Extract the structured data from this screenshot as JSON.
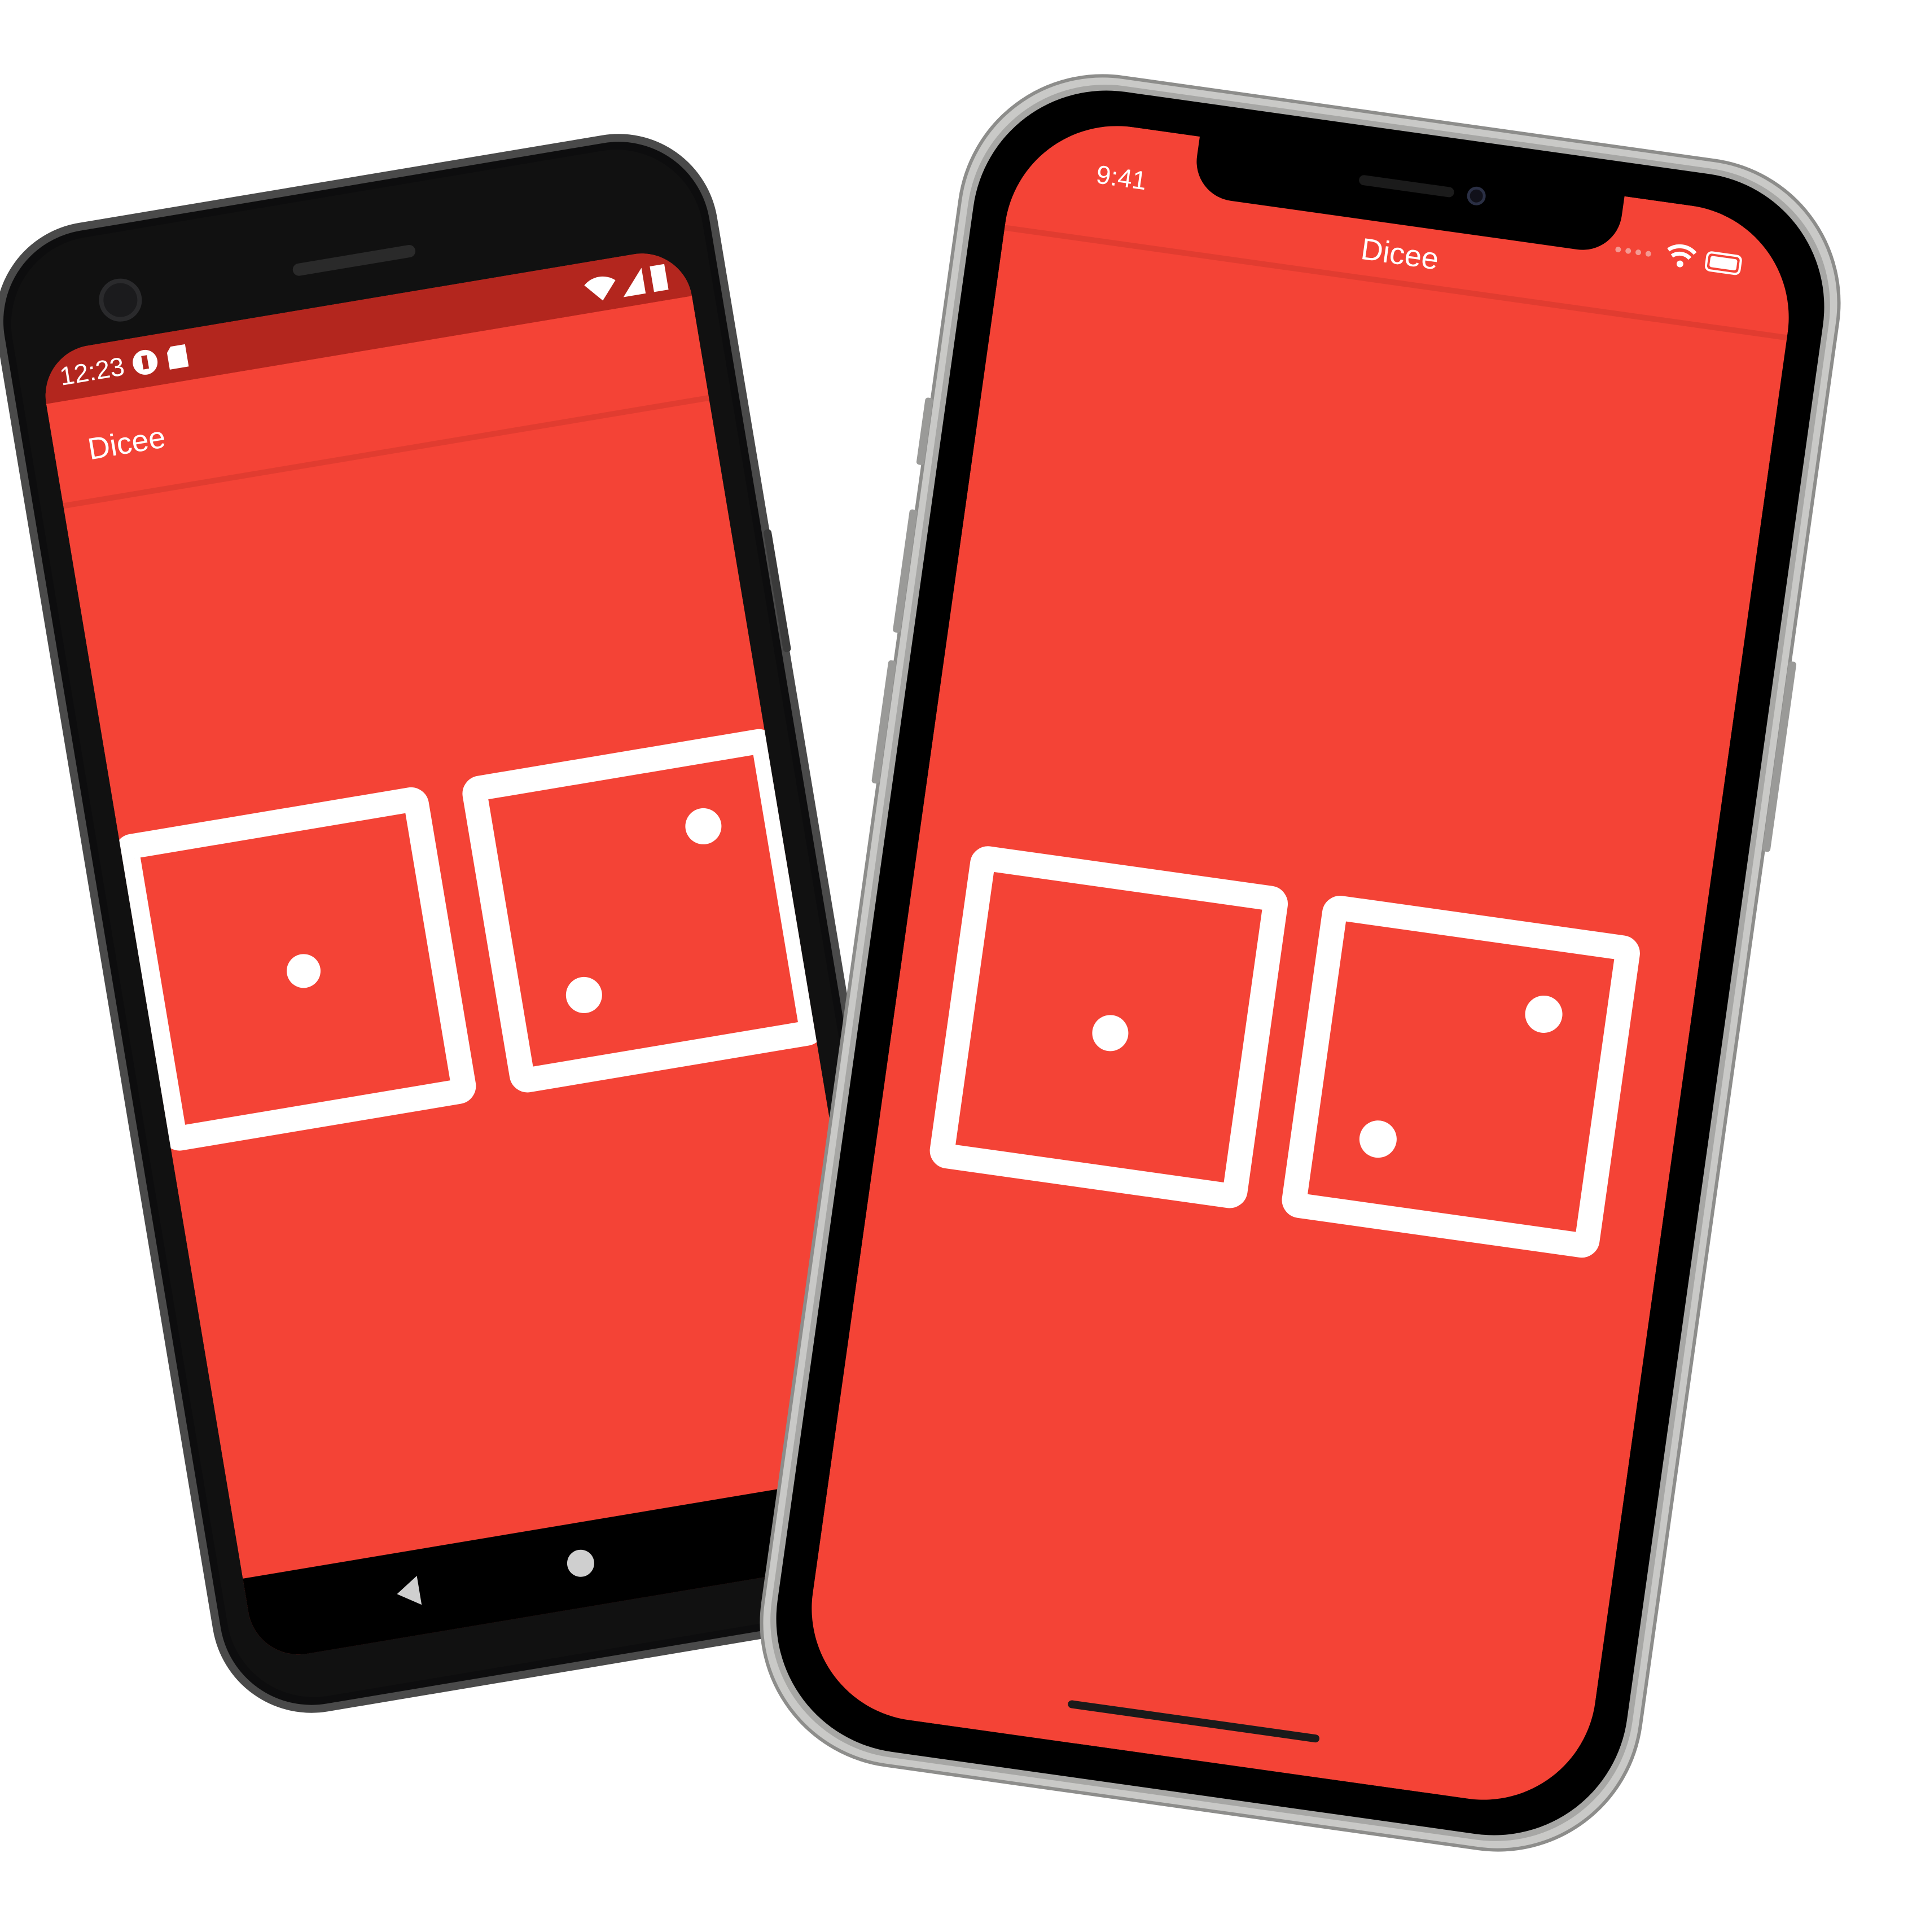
{
  "android": {
    "status_time": "12:23",
    "app_title": "Dicee",
    "left_die_value": 1,
    "right_die_value": 2
  },
  "iphone": {
    "status_time": "9:41",
    "app_title": "Dicee",
    "left_die_value": 1,
    "right_die_value": 2
  },
  "colors": {
    "app_bg": "#F44336",
    "status_bar_android": "#B3261E",
    "device_frame": "#111111",
    "iphone_bezel": "#c9c9c7",
    "die_stroke": "#FFFFFF"
  },
  "icons": {
    "android_status": [
      "notification-icon",
      "sd-card-icon",
      "wifi-icon",
      "signal-icon",
      "battery-icon"
    ],
    "android_nav": [
      "back-icon",
      "home-icon"
    ],
    "iphone_status": [
      "signal-dots-icon",
      "wifi-icon",
      "battery-icon"
    ]
  }
}
